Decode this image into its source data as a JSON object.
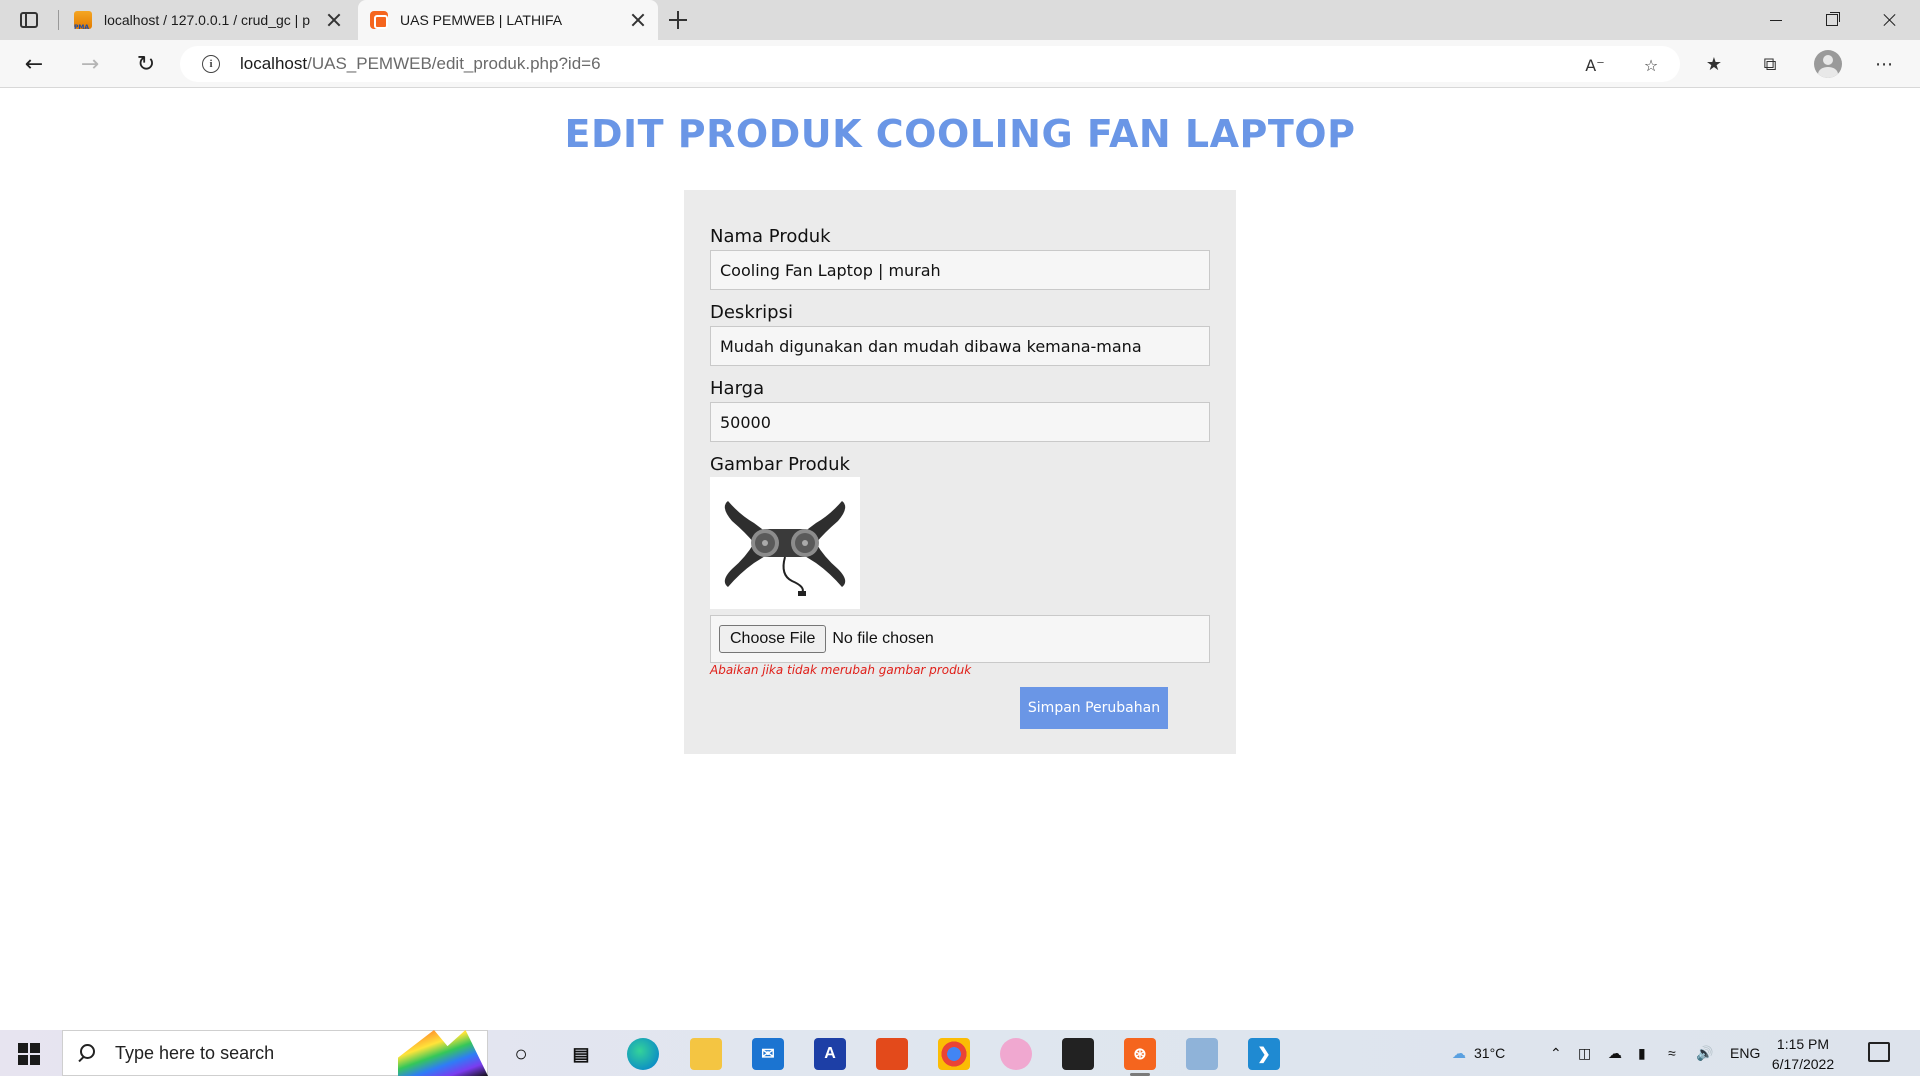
{
  "browser": {
    "tabs": [
      {
        "label": "localhost / 127.0.0.1 / crud_gc | p",
        "favicon": "phpmyadmin-icon",
        "active": false
      },
      {
        "label": "UAS PEMWEB | LATHIFA",
        "favicon": "xampp-icon",
        "active": true
      }
    ],
    "address": {
      "host": "localhost",
      "path": "/UAS_PEMWEB/edit_produk.php?id=6"
    }
  },
  "page": {
    "title": "EDIT PRODUK COOLING FAN LAPTOP",
    "form": {
      "nama_label": "Nama Produk",
      "nama_value": "Cooling Fan Laptop | murah",
      "deskripsi_label": "Deskripsi",
      "deskripsi_value": "Mudah digunakan dan mudah dibawa kemana-mana",
      "harga_label": "Harga",
      "harga_value": "50000",
      "gambar_label": "Gambar Produk",
      "choose_file_label": "Choose File",
      "file_status": "No file chosen",
      "hint": "Abaikan jika tidak merubah gambar produk",
      "submit_label": "Simpan Perubahan"
    }
  },
  "taskbar": {
    "search_placeholder": "Type here to search",
    "weather": "31°C",
    "language": "ENG",
    "time": "1:15 PM",
    "date": "6/17/2022"
  },
  "colors": {
    "accent": "#6a96e6",
    "hint": "#e0201a",
    "card": "#ebebeb"
  }
}
